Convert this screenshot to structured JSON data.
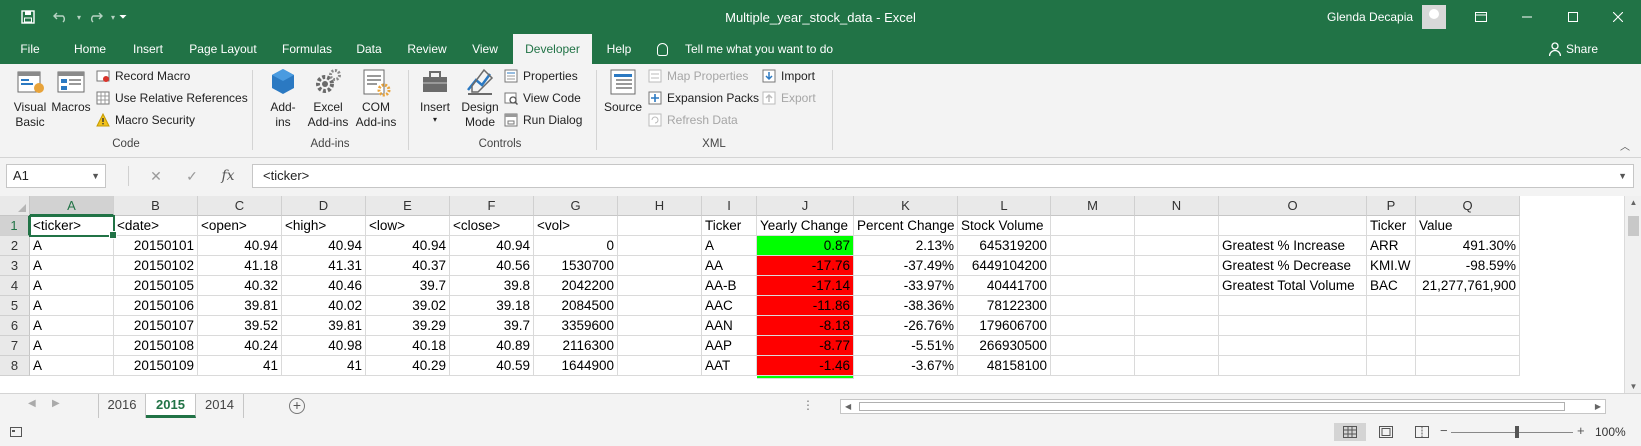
{
  "window": {
    "title": "Multiple_year_stock_data  -  Excel",
    "user": "Glenda Decapia",
    "quick_access": [
      "save-icon",
      "undo-icon",
      "redo-icon",
      "customize-icon"
    ],
    "controls": [
      "ribbon-display-icon",
      "minimize-icon",
      "maximize-icon",
      "close-icon"
    ]
  },
  "tabs": [
    "File",
    "Home",
    "Insert",
    "Page Layout",
    "Formulas",
    "Data",
    "Review",
    "View",
    "Developer",
    "Help"
  ],
  "active_tab": "Developer",
  "tell_me": "Tell me what you want to do",
  "share": "Share",
  "ribbon": {
    "code": {
      "label": "Code",
      "visual_basic": [
        "Visual",
        "Basic"
      ],
      "macros": "Macros",
      "record_macro": "Record Macro",
      "relative_refs": "Use Relative References",
      "macro_security": "Macro Security"
    },
    "addins": {
      "label": "Add-ins",
      "addins": [
        "Add-",
        "ins"
      ],
      "excel_addins": [
        "Excel",
        "Add-ins"
      ],
      "com_addins": [
        "COM",
        "Add-ins"
      ]
    },
    "controls": {
      "label": "Controls",
      "insert": "Insert",
      "design_mode": [
        "Design",
        "Mode"
      ],
      "properties": "Properties",
      "view_code": "View Code",
      "run_dialog": "Run Dialog"
    },
    "xml": {
      "label": "XML",
      "source": "Source",
      "map_properties": "Map Properties",
      "expansion_packs": "Expansion Packs",
      "refresh_data": "Refresh Data",
      "import": "Import",
      "export": "Export"
    }
  },
  "formula_bar": {
    "name_box": "A1",
    "cancel": "✕",
    "enter": "✓",
    "fx": "fx",
    "formula": "<ticker>"
  },
  "sheet": {
    "columns": [
      "A",
      "B",
      "C",
      "D",
      "E",
      "F",
      "G",
      "H",
      "I",
      "J",
      "K",
      "L",
      "M",
      "N",
      "O",
      "P",
      "Q"
    ],
    "selected_column": "A",
    "selected_row": "1",
    "rows": [
      {
        "num": "1",
        "cells": [
          "<ticker>",
          "<date>",
          "<open>",
          "<high>",
          "<low>",
          "<close>",
          "<vol>",
          "",
          "Ticker",
          "Yearly Change",
          "Percent Change",
          "Stock Volume",
          "",
          "",
          "",
          "Ticker",
          "Value"
        ]
      },
      {
        "num": "2",
        "cells": [
          "A",
          "20150101",
          "40.94",
          "40.94",
          "40.94",
          "40.94",
          "0",
          "",
          "A",
          "0.87",
          "2.13%",
          "645319200",
          "",
          "",
          "Greatest % Increase",
          "ARR",
          "491.30%"
        ]
      },
      {
        "num": "3",
        "cells": [
          "A",
          "20150102",
          "41.18",
          "41.31",
          "40.37",
          "40.56",
          "1530700",
          "",
          "AA",
          "-17.76",
          "-37.49%",
          "6449104200",
          "",
          "",
          "Greatest % Decrease",
          "KMI.W",
          "-98.59%"
        ]
      },
      {
        "num": "4",
        "cells": [
          "A",
          "20150105",
          "40.32",
          "40.46",
          "39.7",
          "39.8",
          "2042200",
          "",
          "AA-B",
          "-17.14",
          "-33.97%",
          "40441700",
          "",
          "",
          "Greatest Total Volume",
          "BAC",
          "21,277,761,900"
        ]
      },
      {
        "num": "5",
        "cells": [
          "A",
          "20150106",
          "39.81",
          "40.02",
          "39.02",
          "39.18",
          "2084500",
          "",
          "AAC",
          "-11.86",
          "-38.36%",
          "78122300",
          "",
          "",
          "",
          "",
          ""
        ]
      },
      {
        "num": "6",
        "cells": [
          "A",
          "20150107",
          "39.52",
          "39.81",
          "39.29",
          "39.7",
          "3359600",
          "",
          "AAN",
          "-8.18",
          "-26.76%",
          "179606700",
          "",
          "",
          "",
          "",
          ""
        ]
      },
      {
        "num": "7",
        "cells": [
          "A",
          "20150108",
          "40.24",
          "40.98",
          "40.18",
          "40.89",
          "2116300",
          "",
          "AAP",
          "-8.77",
          "-5.51%",
          "266930500",
          "",
          "",
          "",
          "",
          ""
        ]
      },
      {
        "num": "8",
        "cells": [
          "A",
          "20150109",
          "41",
          "41",
          "40.29",
          "40.59",
          "1644900",
          "",
          "AAT",
          "-1.46",
          "-3.67%",
          "48158100",
          "",
          "",
          "",
          "",
          ""
        ]
      }
    ],
    "yearly_change_fill": [
      "none",
      "green",
      "red",
      "red",
      "red",
      "red",
      "red",
      "red"
    ],
    "colors": {
      "positive": "#00ff00",
      "negative": "#ff0000",
      "accent": "#217346"
    }
  },
  "sheet_tabs": [
    "2016",
    "2015",
    "2014"
  ],
  "active_sheet": "2015",
  "status": {
    "zoom": "100%",
    "zoom_out": "−",
    "zoom_in": "+"
  }
}
